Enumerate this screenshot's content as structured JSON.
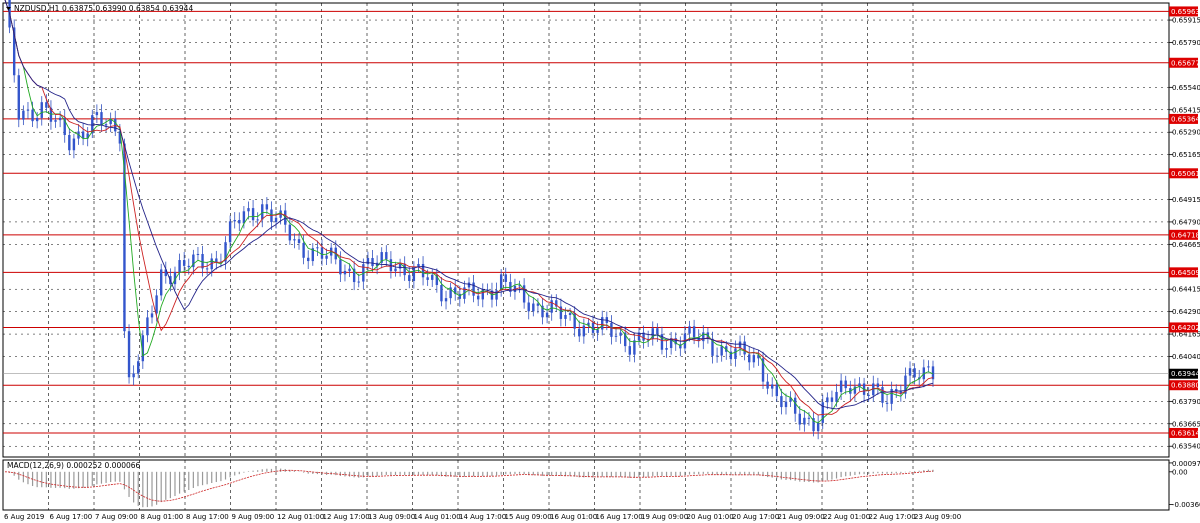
{
  "header": {
    "symbol": "NZDUSD,H1",
    "ohlc": "0.63875 0.63990 0.63854 0.63944"
  },
  "chart_data": {
    "type": "candlestick",
    "price_range": [
      0.6348,
      0.6601
    ],
    "price_ticks": [
      "0.65915",
      "0.65790",
      "0.65540",
      "0.65415",
      "0.65290",
      "0.65165",
      "0.64915",
      "0.64790",
      "0.64665",
      "0.64415",
      "0.64290",
      "0.64165",
      "0.64040",
      "0.63790",
      "0.63665",
      "0.63540"
    ],
    "levels": [
      {
        "value": 0.65963,
        "label": "0.65963"
      },
      {
        "value": 0.65677,
        "label": "0.65677"
      },
      {
        "value": 0.65364,
        "label": "0.65364"
      },
      {
        "value": 0.65061,
        "label": "0.65061"
      },
      {
        "value": 0.64718,
        "label": "0.64718"
      },
      {
        "value": 0.64509,
        "label": "0.64509"
      },
      {
        "value": 0.64202,
        "label": "0.64202"
      },
      {
        "value": 0.6388,
        "label": "0.63880"
      },
      {
        "value": 0.63614,
        "label": "0.63614"
      }
    ],
    "current_price": {
      "value": 0.63944,
      "label": "0.63944"
    },
    "time_labels": [
      "6 Aug 2019",
      "6 Aug 17:00",
      "7 Aug 09:00",
      "8 Aug 01:00",
      "8 Aug 17:00",
      "9 Aug 09:00",
      "12 Aug 01:00",
      "12 Aug 17:00",
      "13 Aug 09:00",
      "14 Aug 01:00",
      "14 Aug 17:00",
      "15 Aug 09:00",
      "16 Aug 01:00",
      "16 Aug 17:00",
      "19 Aug 09:00",
      "20 Aug 01:00",
      "20 Aug 17:00",
      "21 Aug 09:00",
      "22 Aug 01:00",
      "22 Aug 17:00",
      "23 Aug 09:00"
    ],
    "path_points": [
      [
        0,
        0.66
      ],
      [
        3,
        0.654
      ],
      [
        8,
        0.6542
      ],
      [
        14,
        0.6525
      ],
      [
        20,
        0.6535
      ],
      [
        25,
        0.653
      ],
      [
        26,
        0.642
      ],
      [
        27,
        0.639
      ],
      [
        30,
        0.641
      ],
      [
        34,
        0.645
      ],
      [
        40,
        0.6455
      ],
      [
        46,
        0.6458
      ],
      [
        50,
        0.6478
      ],
      [
        56,
        0.6488
      ],
      [
        60,
        0.6478
      ],
      [
        64,
        0.6465
      ],
      [
        68,
        0.6462
      ],
      [
        72,
        0.6456
      ],
      [
        76,
        0.645
      ],
      [
        80,
        0.6455
      ],
      [
        84,
        0.6458
      ],
      [
        88,
        0.645
      ],
      [
        92,
        0.6448
      ],
      [
        96,
        0.644
      ],
      [
        100,
        0.6438
      ],
      [
        104,
        0.644
      ],
      [
        108,
        0.6445
      ],
      [
        112,
        0.6438
      ],
      [
        116,
        0.6432
      ],
      [
        120,
        0.6428
      ],
      [
        124,
        0.6423
      ],
      [
        128,
        0.642
      ],
      [
        132,
        0.6418
      ],
      [
        136,
        0.6412
      ],
      [
        140,
        0.6414
      ],
      [
        144,
        0.6412
      ],
      [
        148,
        0.6415
      ],
      [
        152,
        0.6413
      ],
      [
        156,
        0.6408
      ],
      [
        160,
        0.6405
      ],
      [
        164,
        0.6402
      ],
      [
        168,
        0.638
      ],
      [
        172,
        0.6372
      ],
      [
        176,
        0.6368
      ],
      [
        180,
        0.638
      ],
      [
        184,
        0.639
      ],
      [
        188,
        0.6385
      ],
      [
        192,
        0.6378
      ],
      [
        196,
        0.6395
      ],
      [
        200,
        0.6392
      ],
      [
        202,
        0.6394
      ]
    ],
    "indicator": {
      "name": "MACD(12,26,9) 0.000252 0.000066",
      "ticks": [
        "0.000978",
        "0.00",
        "-0.003603"
      ],
      "range": [
        -0.0042,
        0.0013
      ]
    }
  }
}
